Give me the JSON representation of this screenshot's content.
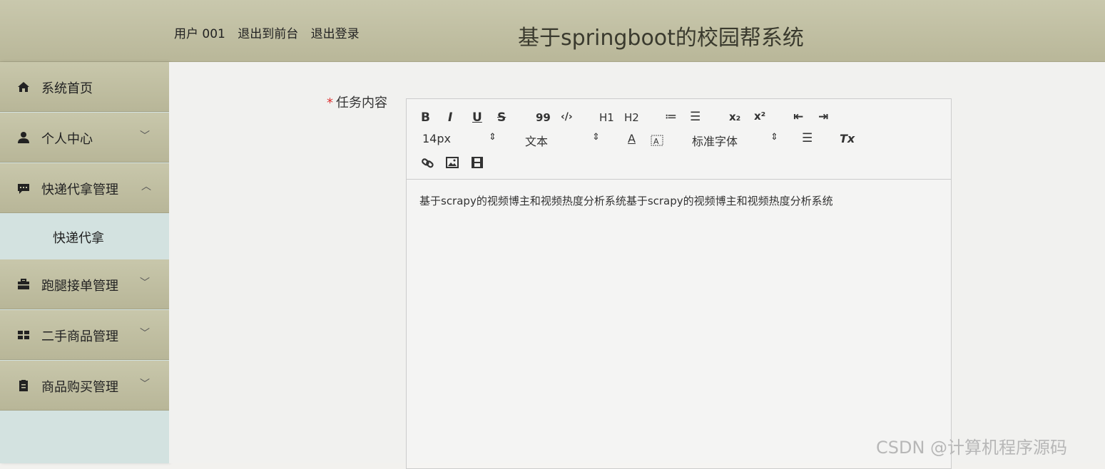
{
  "header": {
    "user_label": "用户 001",
    "exit_front_label": "退出到前台",
    "logout_label": "退出登录",
    "app_title": "基于springboot的校园帮系统"
  },
  "sidebar": {
    "items": [
      {
        "label": "系统首页",
        "icon": "home-icon"
      },
      {
        "label": "个人中心",
        "icon": "user-icon",
        "chevron": "﹀"
      },
      {
        "label": "快递代拿管理",
        "icon": "message-icon",
        "chevron": "︿"
      },
      {
        "label": "跑腿接单管理",
        "icon": "briefcase-icon",
        "chevron": "﹀"
      },
      {
        "label": "二手商品管理",
        "icon": "grid-icon",
        "chevron": "﹀"
      },
      {
        "label": "商品购买管理",
        "icon": "clipboard-icon",
        "chevron": "﹀"
      }
    ],
    "submenu": {
      "label": "快递代拿"
    }
  },
  "form": {
    "required_mark": "*",
    "field_label": "任务内容"
  },
  "editor": {
    "toolbar": {
      "bold": "B",
      "italic": "I",
      "underline": "U",
      "strike": "S",
      "blockquote": "99",
      "code": "‹/›",
      "h1": "H1",
      "h2": "H2",
      "ordered_list": "≔",
      "bullet_list": "☰",
      "subscript": "x₂",
      "superscript": "x²",
      "outdent": "⇤",
      "indent": "⇥",
      "font_size": "14px",
      "header_select": "文本",
      "font_color": "A",
      "font_family": "标准字体",
      "align": "☰",
      "clean": "Tx",
      "select_arrow": "⇕"
    },
    "content": "基于scrapy的视频博主和视频热度分析系统基于scrapy的视频博主和视频热度分析系统"
  },
  "watermark": "CSDN @计算机程序源码",
  "colors": {
    "header_bg": "#c4c3a6",
    "menu_bg": "#bebd9f",
    "submenu_bg": "#d3e2e0",
    "required": "#dd3333"
  }
}
